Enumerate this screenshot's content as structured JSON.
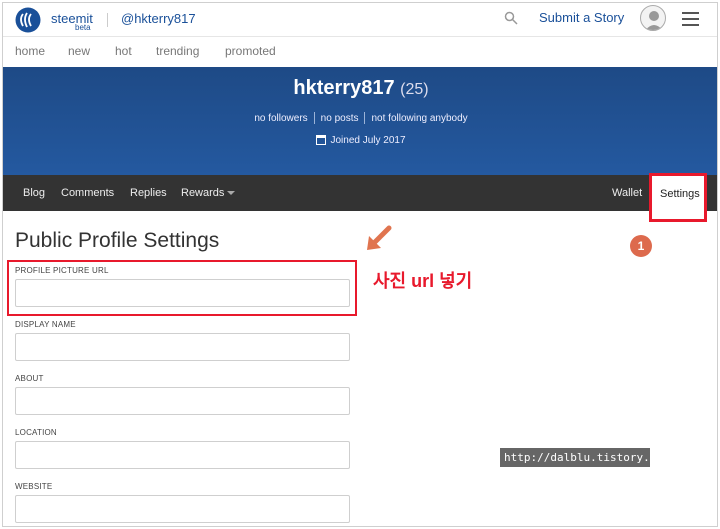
{
  "header": {
    "brand": "steemit",
    "brand_tag": "beta",
    "user_handle": "@hkterry817",
    "search_icon": "search-icon",
    "submit_label": "Submit a Story",
    "avatar_icon": "avatar-icon",
    "menu_icon": "hamburger-menu-icon"
  },
  "subnav": [
    "home",
    "new",
    "hot",
    "trending",
    "promoted"
  ],
  "profile": {
    "name": "hkterry817",
    "reputation": "(25)",
    "followers": "no followers",
    "posts": "no posts",
    "following": "not following anybody",
    "joined": "Joined July 2017"
  },
  "tabs": {
    "blog": "Blog",
    "comments": "Comments",
    "replies": "Replies",
    "rewards": "Rewards",
    "wallet": "Wallet",
    "settings": "Settings"
  },
  "settings": {
    "title": "Public Profile Settings",
    "fields": {
      "profile_picture_url": {
        "label": "PROFILE PICTURE URL",
        "value": ""
      },
      "display_name": {
        "label": "DISPLAY NAME",
        "value": ""
      },
      "about": {
        "label": "ABOUT",
        "value": ""
      },
      "location": {
        "label": "LOCATION",
        "value": ""
      },
      "website": {
        "label": "WEBSITE",
        "value": ""
      }
    }
  },
  "annotations": {
    "instruction": "사진 url 넣기",
    "step_badge": "1",
    "watermark": "http://dalblu.tistory.com",
    "highlight_color": "#e8192c",
    "arrow_color": "#e0744f"
  },
  "colors": {
    "brand_blue": "#1a5099",
    "banner_blue": "#2459a0",
    "tab_bar": "#333333"
  }
}
